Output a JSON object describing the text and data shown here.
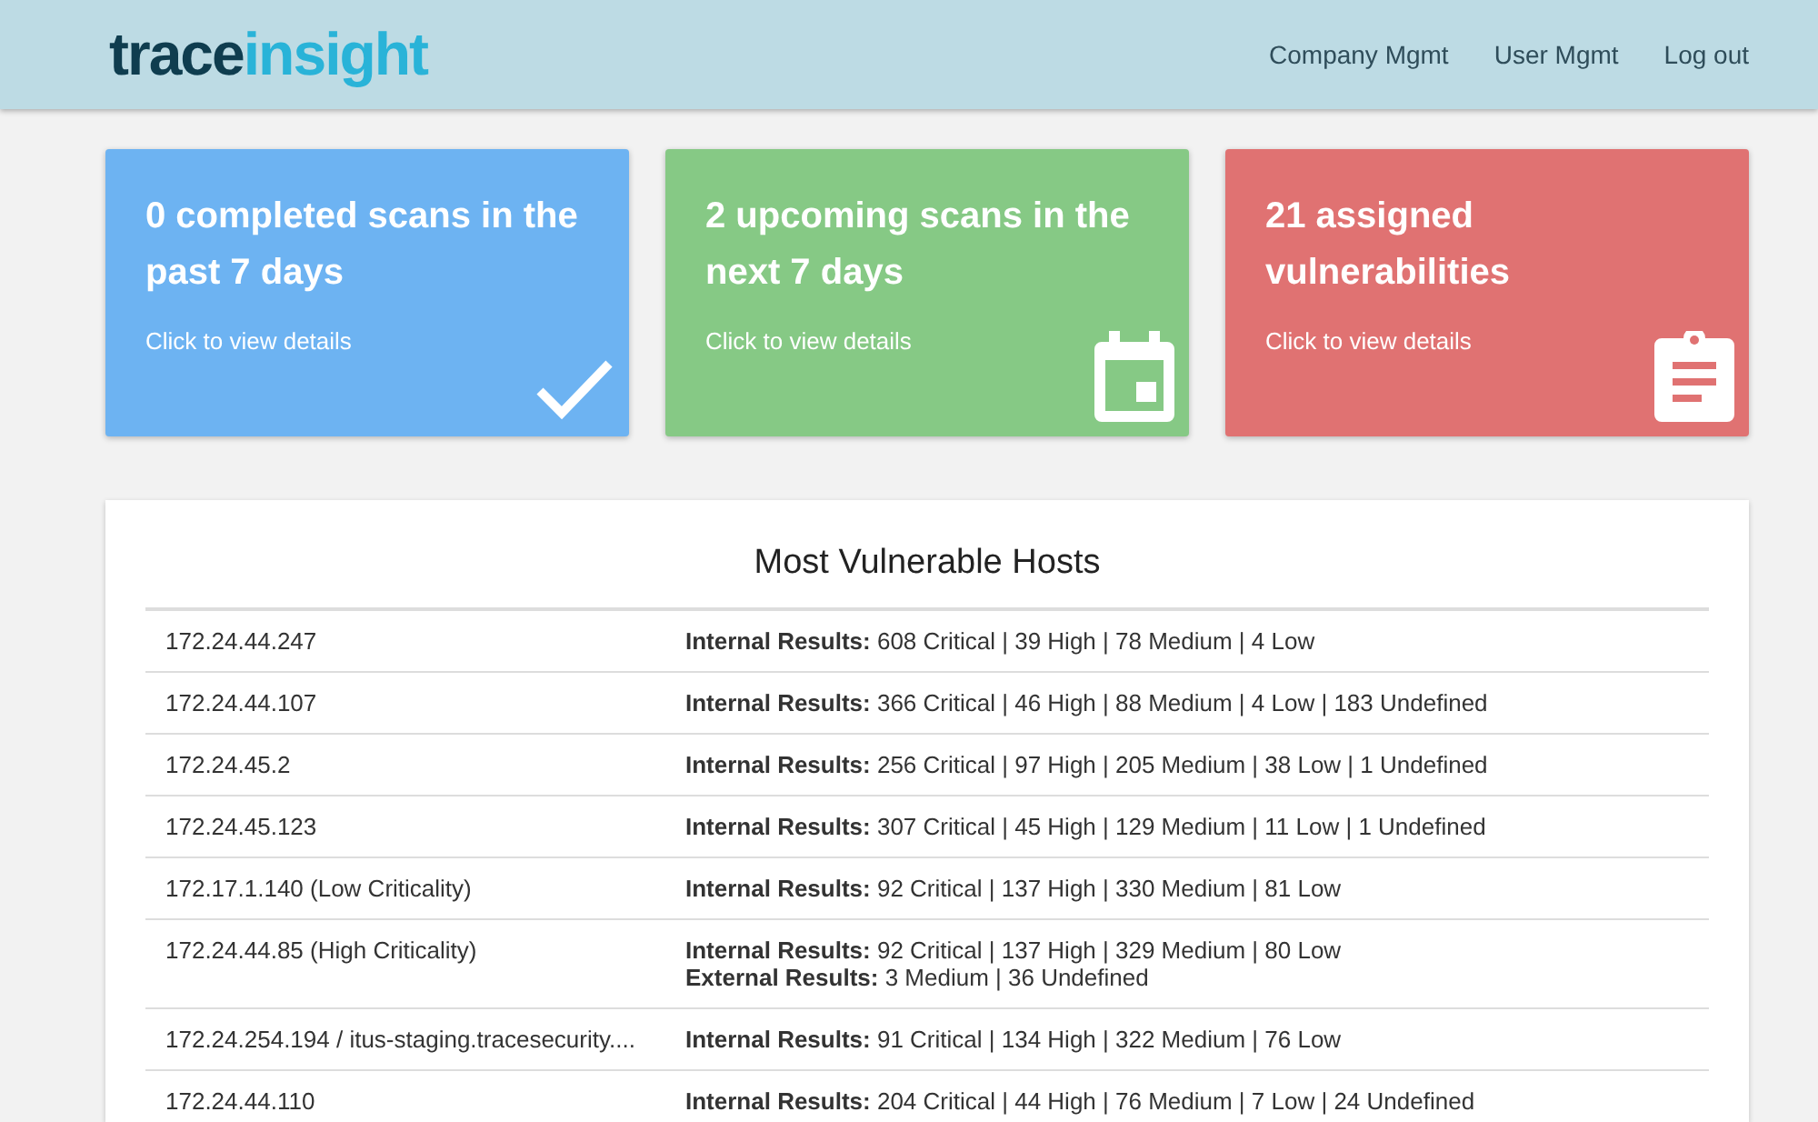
{
  "header": {
    "logo": {
      "part_1": "trace",
      "part_2": "insight"
    },
    "nav": [
      {
        "label": "Company Mgmt"
      },
      {
        "label": "User Mgmt"
      },
      {
        "label": "Log out"
      }
    ]
  },
  "cards": [
    {
      "title": "0 completed scans in the past 7 days",
      "link": "Click to view details",
      "color": "#6db3f2",
      "kind": "check"
    },
    {
      "title": "2 upcoming scans in the next 7 days",
      "link": "Click to view details",
      "color": "#86c985",
      "kind": "calendar"
    },
    {
      "title": "21 assigned vulnerabilities",
      "link": "Click to view details",
      "color": "#e07272",
      "kind": "clipboard"
    }
  ],
  "hosts_panel": {
    "title": "Most Vulnerable Hosts",
    "rows": [
      {
        "host": "172.24.44.247",
        "results": [
          "**Internal Results:** 608 Critical | 39 High | 78 Medium | 4 Low"
        ]
      },
      {
        "host": "172.24.44.107",
        "results": [
          "**Internal Results:** 366 Critical | 46 High | 88 Medium | 4 Low | 183 Undefined"
        ]
      },
      {
        "host": "172.24.45.2",
        "results": [
          "**Internal Results:** 256 Critical | 97 High | 205 Medium | 38 Low | 1 Undefined"
        ]
      },
      {
        "host": "172.24.45.123",
        "results": [
          "**Internal Results:** 307 Critical | 45 High | 129 Medium | 11 Low | 1 Undefined"
        ]
      },
      {
        "host": "172.17.1.140 (Low Criticality)",
        "results": [
          "**Internal Results:** 92 Critical | 137 High | 330 Medium | 81 Low"
        ]
      },
      {
        "host": "172.24.44.85 (High Criticality)",
        "results": [
          "**Internal Results:** 92 Critical | 137 High | 329 Medium | 80 Low",
          "**External Results:** 3 Medium | 36 Undefined"
        ]
      },
      {
        "host": "172.24.254.194 / itus-staging.tracesecurity....",
        "results": [
          "**Internal Results:** 91 Critical | 134 High | 322 Medium | 76 Low"
        ]
      },
      {
        "host": "172.24.44.110",
        "results": [
          "**Internal Results:** 204 Critical | 44 High | 76 Medium | 7 Low | 24 Undefined"
        ]
      }
    ]
  }
}
